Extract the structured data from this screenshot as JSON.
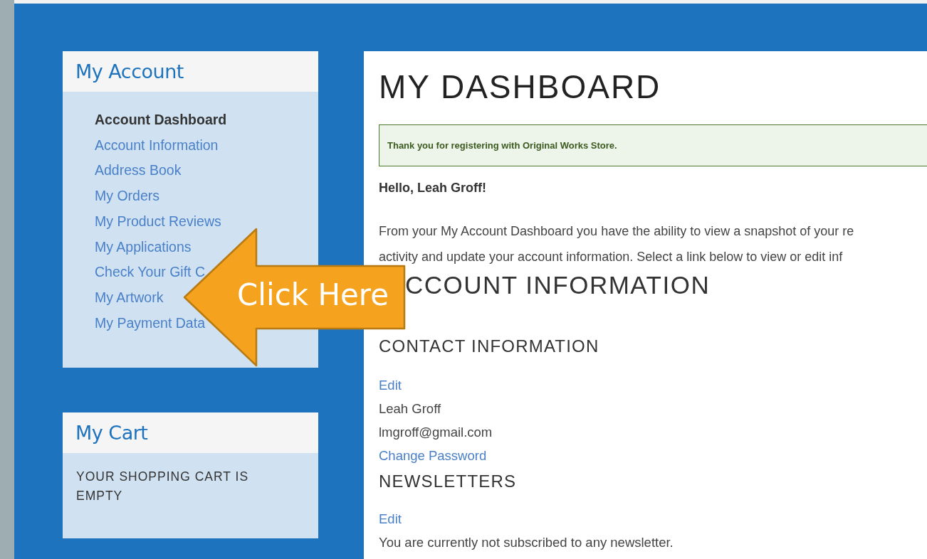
{
  "sidebar": {
    "title": "My Account",
    "items": [
      {
        "label": "Account Dashboard",
        "selected": true
      },
      {
        "label": "Account Information",
        "selected": false
      },
      {
        "label": "Address Book",
        "selected": false
      },
      {
        "label": "My Orders",
        "selected": false
      },
      {
        "label": "My Product Reviews",
        "selected": false
      },
      {
        "label": "My Applications",
        "selected": false
      },
      {
        "label": "Check Your Gift C",
        "selected": false
      },
      {
        "label": "My Artwork",
        "selected": false
      },
      {
        "label": "My Payment Data",
        "selected": false
      }
    ]
  },
  "cart": {
    "title": "My Cart",
    "message": "YOUR SHOPPING CART IS EMPTY"
  },
  "main": {
    "title": "MY DASHBOARD",
    "notice": "Thank you for registering with Original Works Store.",
    "greeting": "Hello, Leah Groff!",
    "intro_lines": [
      "From your My Account Dashboard you have the ability to view a snapshot of your re",
      "activity and update your account information. Select a link below to view or edit inf"
    ],
    "section_title": "CCOUNT INFORMATION",
    "contact": {
      "title": "CONTACT INFORMATION",
      "edit": "Edit",
      "name": "Leah Groff",
      "email": "lmgroff@gmail.com",
      "change_password": "Change Password"
    },
    "newsletters": {
      "title": "NEWSLETTERS",
      "edit": "Edit",
      "status": "You are currently not subscribed to any newsletter."
    }
  },
  "callout": {
    "label": "Click Here"
  }
}
